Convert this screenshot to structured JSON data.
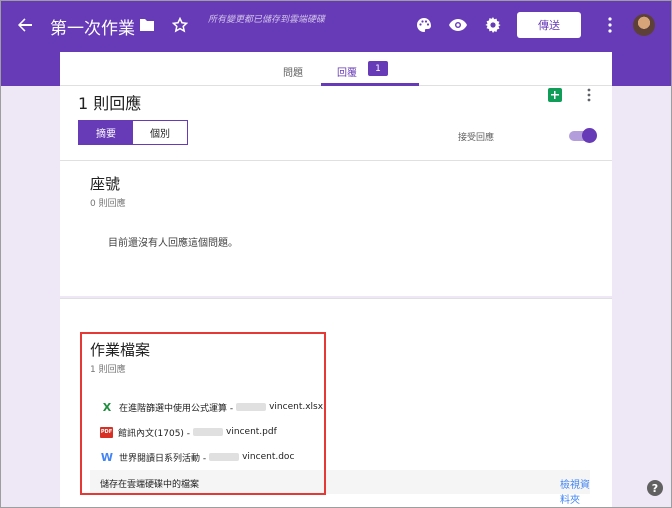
{
  "header": {
    "title": "第一次作業",
    "saved_status": "所有變更都已儲存到雲端硬碟",
    "send_label": "傳送",
    "icons": [
      "arrow-back-icon",
      "folder-icon",
      "star-icon",
      "palette-icon",
      "eye-icon",
      "gear-icon",
      "more-vert-icon",
      "avatar"
    ],
    "brand_color": "#673ab7"
  },
  "tabs": {
    "questions": "問題",
    "responses": "回覆",
    "responses_count": "1"
  },
  "summary": {
    "count_label": "1 則回應",
    "view_summary": "摘要",
    "view_individual": "個別",
    "accepting_label": "接受回應",
    "accepting_on": true
  },
  "question1": {
    "title": "座號",
    "count": "0 則回應",
    "empty_text": "目前還沒有人回應這個問題。"
  },
  "question2": {
    "title": "作業檔案",
    "count": "1 則回應",
    "files": [
      {
        "type": "xlsx",
        "icon": "excel-icon",
        "name": "在進階篩選中使用公式運算 -",
        "owner": "vincent.xlsx"
      },
      {
        "type": "pdf",
        "icon": "pdf-icon",
        "name": "館訊內文(1705) -",
        "owner": "vincent.pdf"
      },
      {
        "type": "doc",
        "icon": "word-icon",
        "name": "世界閱讀日系列活動 -",
        "owner": "vincent.doc"
      }
    ],
    "drive_text": "儲存在雲端硬碟中的檔案",
    "view_folder": "檢視資料夾"
  },
  "help": {
    "label": "?"
  }
}
